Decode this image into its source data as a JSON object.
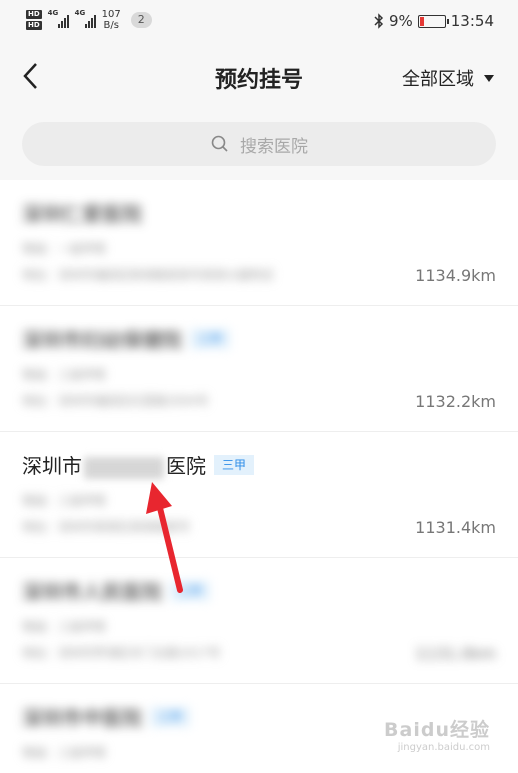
{
  "status_bar": {
    "hd1": "HD",
    "hd2": "HD",
    "net1": "4G",
    "net2": "4G",
    "speed_value": "107",
    "speed_unit": "B/s",
    "notification_count": "2",
    "battery": "9%",
    "time": "13:54"
  },
  "header": {
    "title": "预约挂号",
    "region": "全部区域"
  },
  "search": {
    "placeholder": "搜索医院"
  },
  "hospitals": [
    {
      "name": "深圳仁爱医院",
      "badge": "",
      "level": "等级：一级甲等",
      "address": "地址：深圳市福田区新闻路某某号某某大厦附近",
      "distance": "1134.9km"
    },
    {
      "name": "深圳市妇幼保健院",
      "badge": "三甲",
      "level": "等级：三级甲等",
      "address": "地址：深圳市福田区红荔路2004号",
      "distance": "1132.2km"
    },
    {
      "name_prefix": "深圳市",
      "name_suffix": "医院",
      "badge": "三甲",
      "level": "等级：三级甲等",
      "address": "地址：深圳市某某区某某路某号",
      "distance": "1131.4km"
    },
    {
      "name": "深圳市人民医院",
      "badge": "三甲",
      "level": "等级：三级甲等",
      "address": "地址：深圳市罗湖区东门北路1017号",
      "distance": "1131.0km"
    },
    {
      "name": "深圳市中医院",
      "badge": "三甲",
      "level": "等级：三级甲等",
      "address": "",
      "distance": ""
    }
  ],
  "watermark": {
    "brand": "Baidu经验",
    "url": "jingyan.baidu.com"
  },
  "colors": {
    "accent_badge": "#2e8de8",
    "arrow": "#e8262f",
    "battery_low": "#e53935"
  }
}
